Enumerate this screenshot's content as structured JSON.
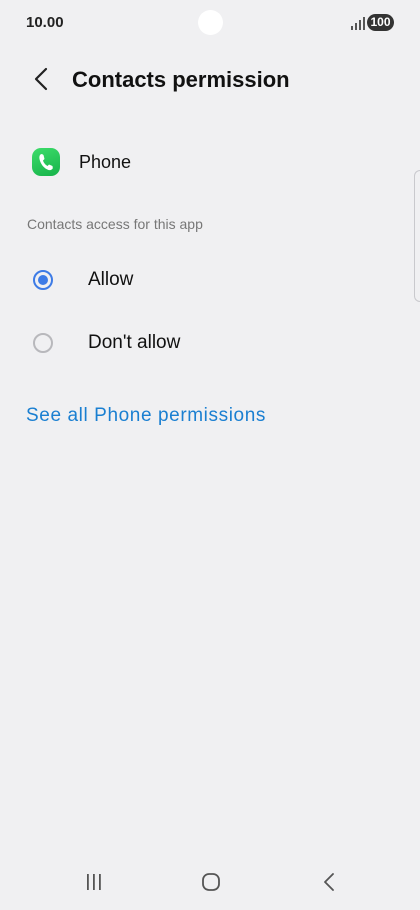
{
  "status_bar": {
    "time": "10.00",
    "battery": "100",
    "signal_icon": "signal-bars-icon"
  },
  "header": {
    "back_icon": "chevron-left-icon",
    "title": "Contacts permission"
  },
  "app": {
    "icon": "phone-app-icon",
    "name": "Phone",
    "icon_color": "#1fc25a"
  },
  "section": {
    "label": "Contacts access for this app"
  },
  "options": [
    {
      "label": "Allow",
      "selected": true
    },
    {
      "label": "Don't allow",
      "selected": false
    }
  ],
  "link": {
    "label": "See all Phone permissions",
    "color": "#1a7fd1"
  },
  "accent_color": "#3d7be6",
  "nav_bar": {
    "recents_icon": "recents-icon",
    "home_icon": "home-icon",
    "back_icon": "back-icon"
  }
}
